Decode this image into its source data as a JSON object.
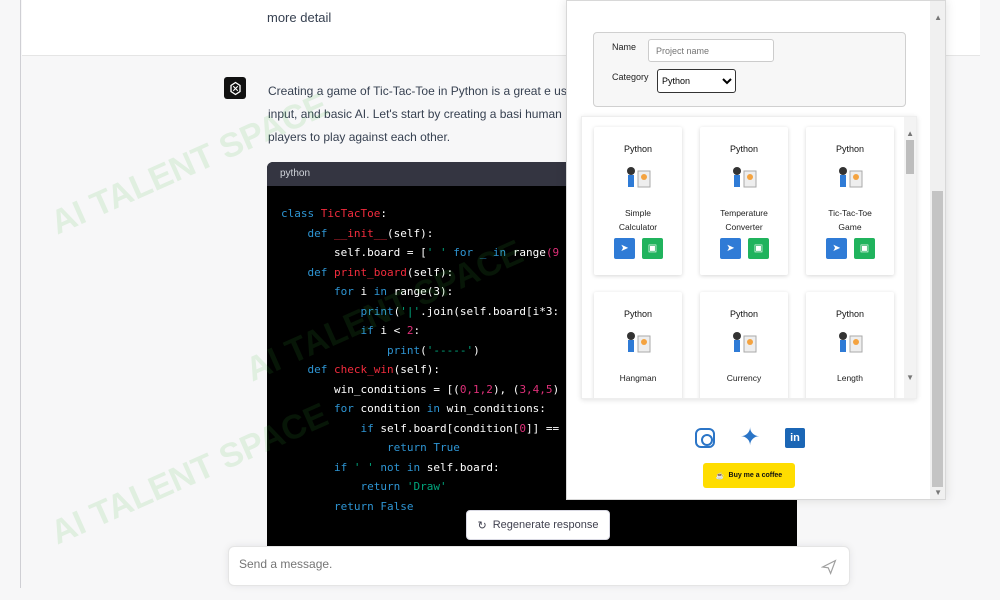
{
  "chat": {
    "user_text": "more detail",
    "answer": "Creating a game of Tic-Tac-Toe in Python is a great e user input, and basic AI. Let's start by creating a basi human players to play against each other.",
    "code_language": "python",
    "regenerate_label": "Regenerate response",
    "message_placeholder": "Send a message."
  },
  "code_lines": [
    {
      "parts": [
        {
          "text": "class ",
          "cls": "kw"
        },
        {
          "text": "TicTacToe",
          "cls": "fn"
        },
        {
          "text": ":",
          "cls": ""
        }
      ]
    },
    {
      "parts": [
        {
          "text": "    def ",
          "cls": "kw"
        },
        {
          "text": "__init__",
          "cls": "fn"
        },
        {
          "text": "(self):",
          "cls": ""
        }
      ]
    },
    {
      "parts": [
        {
          "text": "        self.board = [",
          "cls": ""
        },
        {
          "text": "' '",
          "cls": "str"
        },
        {
          "text": " for _ in ",
          "cls": "kw"
        },
        {
          "text": "range",
          "cls": ""
        },
        {
          "text": "(9",
          "cls": "num"
        }
      ]
    },
    {
      "parts": [
        {
          "text": "",
          "cls": ""
        }
      ]
    },
    {
      "parts": [
        {
          "text": "    def ",
          "cls": "kw"
        },
        {
          "text": "print_board",
          "cls": "fn"
        },
        {
          "text": "(self):",
          "cls": ""
        }
      ]
    },
    {
      "parts": [
        {
          "text": "        for ",
          "cls": "kw"
        },
        {
          "text": "i ",
          "cls": ""
        },
        {
          "text": "in ",
          "cls": "kw"
        },
        {
          "text": "range(3):",
          "cls": ""
        }
      ]
    },
    {
      "parts": [
        {
          "text": "            print",
          "cls": "kw"
        },
        {
          "text": "(",
          "cls": ""
        },
        {
          "text": "'|'",
          "cls": "str"
        },
        {
          "text": ".join(self.board[i*3:",
          "cls": ""
        }
      ]
    },
    {
      "parts": [
        {
          "text": "            if ",
          "cls": "kw"
        },
        {
          "text": "i < ",
          "cls": ""
        },
        {
          "text": "2",
          "cls": "num"
        },
        {
          "text": ":",
          "cls": ""
        }
      ]
    },
    {
      "parts": [
        {
          "text": "                print",
          "cls": "kw"
        },
        {
          "text": "(",
          "cls": ""
        },
        {
          "text": "'-----'",
          "cls": "str"
        },
        {
          "text": ")",
          "cls": ""
        }
      ]
    },
    {
      "parts": [
        {
          "text": "",
          "cls": ""
        }
      ]
    },
    {
      "parts": [
        {
          "text": "    def ",
          "cls": "kw"
        },
        {
          "text": "check_win",
          "cls": "fn"
        },
        {
          "text": "(self):",
          "cls": ""
        }
      ]
    },
    {
      "parts": [
        {
          "text": "        win_conditions = [(",
          "cls": ""
        },
        {
          "text": "0,1,2",
          "cls": "num"
        },
        {
          "text": "), (",
          "cls": ""
        },
        {
          "text": "3,4,5",
          "cls": "num"
        },
        {
          "text": ")",
          "cls": ""
        }
      ]
    },
    {
      "parts": [
        {
          "text": "        for ",
          "cls": "kw"
        },
        {
          "text": "condition ",
          "cls": ""
        },
        {
          "text": "in ",
          "cls": "kw"
        },
        {
          "text": "win_conditions:",
          "cls": ""
        }
      ]
    },
    {
      "parts": [
        {
          "text": "            if ",
          "cls": "kw"
        },
        {
          "text": "self.board[condition[",
          "cls": ""
        },
        {
          "text": "0",
          "cls": "num"
        },
        {
          "text": "]] ==",
          "cls": ""
        }
      ]
    },
    {
      "parts": [
        {
          "text": "                return ",
          "cls": "kw"
        },
        {
          "text": "True",
          "cls": "kw"
        }
      ]
    },
    {
      "parts": [
        {
          "text": "        if ",
          "cls": "kw"
        },
        {
          "text": "' '",
          "cls": "str"
        },
        {
          "text": " not in ",
          "cls": "kw"
        },
        {
          "text": "self.board:",
          "cls": ""
        }
      ]
    },
    {
      "parts": [
        {
          "text": "            return ",
          "cls": "kw"
        },
        {
          "text": "'Draw'",
          "cls": "str"
        }
      ]
    },
    {
      "parts": [
        {
          "text": "        return ",
          "cls": "kw"
        },
        {
          "text": "False",
          "cls": "kw"
        }
      ]
    }
  ],
  "panel": {
    "name_label": "Name",
    "name_placeholder": "Project name",
    "category_label": "Category",
    "category_value": "Python",
    "cards": [
      {
        "category": "Python",
        "title": "Simple\nCalculator",
        "icon": "person-calculator-icon"
      },
      {
        "category": "Python",
        "title": "Temperature\nConverter",
        "icon": "cloud-thermometer-icon"
      },
      {
        "category": "Python",
        "title": "Tic-Tac-Toe\nGame",
        "icon": "game-controller-icon"
      },
      {
        "category": "Python",
        "title": "Hangman",
        "icon": "hangman-icon"
      },
      {
        "category": "Python",
        "title": "Currency",
        "icon": "currency-icon"
      },
      {
        "category": "Python",
        "title": "Length",
        "icon": "phone-length-icon"
      }
    ],
    "coffee_label": "Buy me a coffee"
  },
  "watermark": "AI TALENT SPACE",
  "colors": {
    "accent_blue": "#2f7bd6",
    "accent_green": "#20b35d",
    "coffee_yellow": "#ffdd00"
  }
}
